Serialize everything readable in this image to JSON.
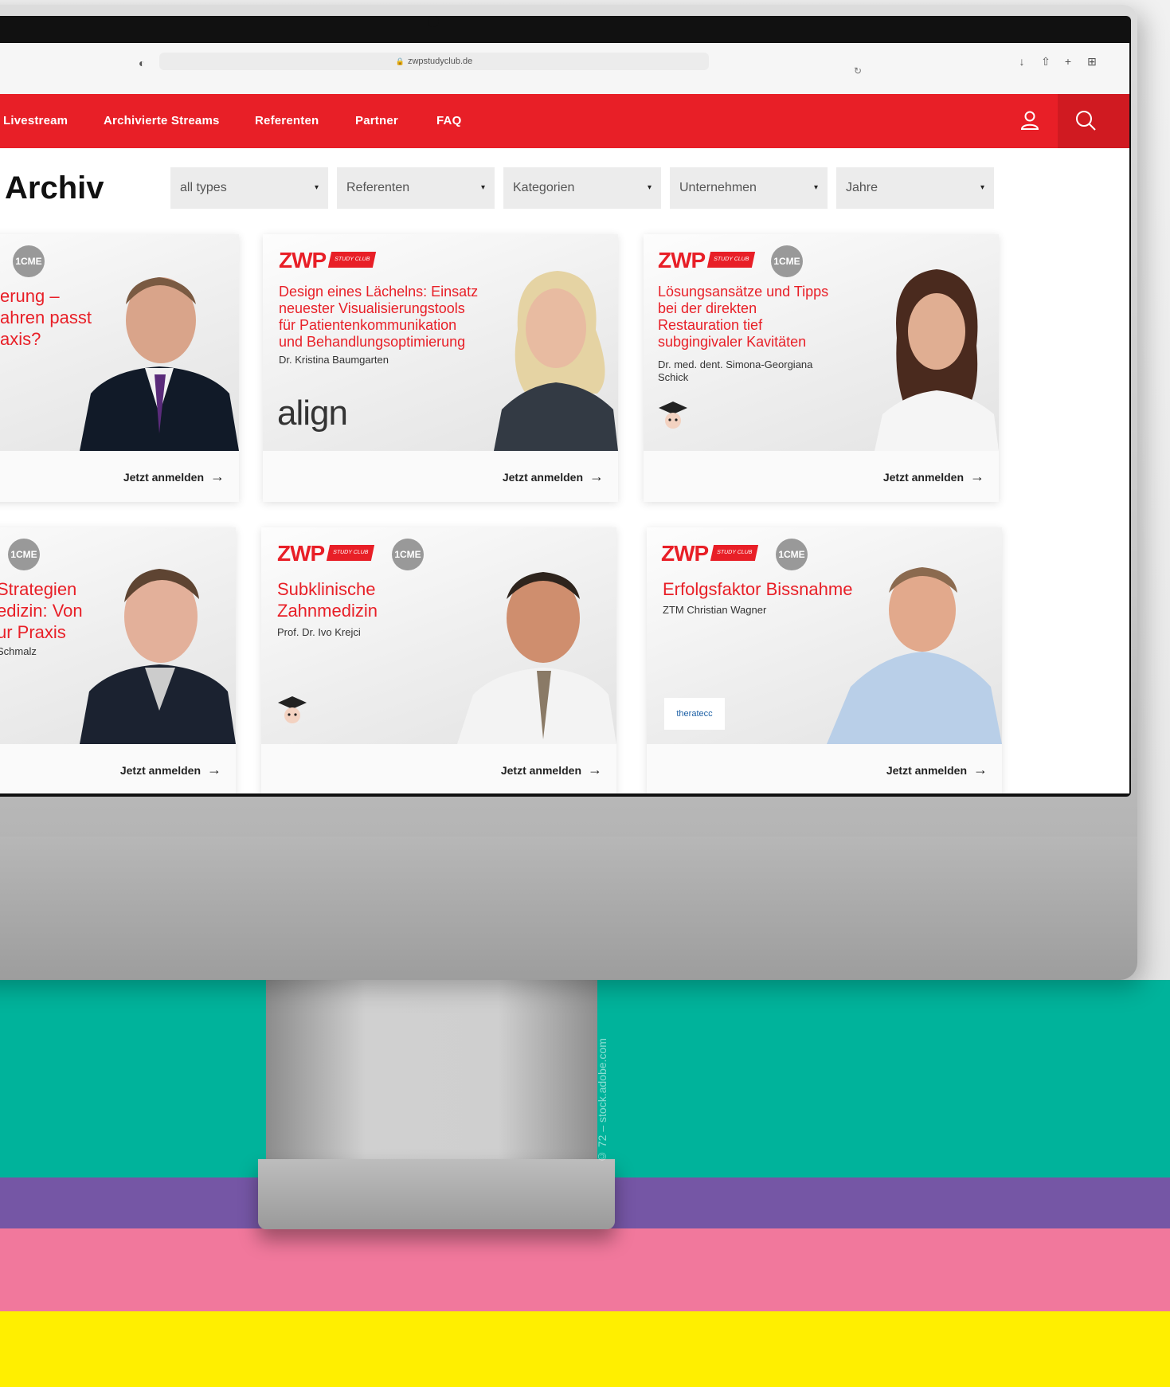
{
  "browser": {
    "url": "zwpstudyclub.de",
    "lock": "🔒",
    "shield": "◐",
    "reload": "↻",
    "toolbar_icons": [
      "↓",
      "⇧",
      "+",
      "⊞"
    ]
  },
  "nav": {
    "items": [
      "Livestream",
      "Archivierte Streams",
      "Referenten",
      "Partner",
      "FAQ"
    ],
    "color": "#e81f27"
  },
  "page": {
    "title": "Archiv"
  },
  "filters": [
    "all types",
    "Referenten",
    "Kategorien",
    "Unternehmen",
    "Jahre"
  ],
  "filter_arrow": "▾",
  "brand": {
    "zwp": "ZWP",
    "studyclub": "STUDY CLUB",
    "cme": "1CME"
  },
  "cards": [
    {
      "title": "erung –\nahren passt\naxis?",
      "speaker": "",
      "cta": "Jetzt anmelden"
    },
    {
      "title": "Design eines Lächelns: Einsatz\nneuester Visualisierungstools\nfür Patientenkommunikation\nund Behandlungsoptimierung",
      "speaker": "Dr. Kristina Baumgarten",
      "sponsor": "align",
      "cta": "Jetzt anmelden"
    },
    {
      "title": "Lösungsansätze und Tipps\nbei der direkten\nRestauration tief\nsubgingivaler Kavitäten",
      "speaker": "Dr. med. dent. Simona-Georgiana\nSchick",
      "cta": "Jetzt anmelden"
    },
    {
      "title": "Strategien\nedizin: Von\nur Praxis",
      "speaker": "Schmalz",
      "cta": "Jetzt anmelden"
    },
    {
      "title": "Subklinische\nZahnmedizin",
      "speaker": "Prof. Dr. Ivo Krejci",
      "cta": "Jetzt anmelden"
    },
    {
      "title": "Erfolgsfaktor Bissnahme",
      "speaker": "ZTM Christian Wagner",
      "sponsor": "theratecc",
      "cta": "Jetzt anmelden"
    }
  ],
  "arrow": "→",
  "credit": "© 72 – stock.adobe.com",
  "colors": {
    "teal": "#00b39b",
    "purple": "#7556a5",
    "pink": "#f1789c",
    "yellow": "#ffef00"
  }
}
